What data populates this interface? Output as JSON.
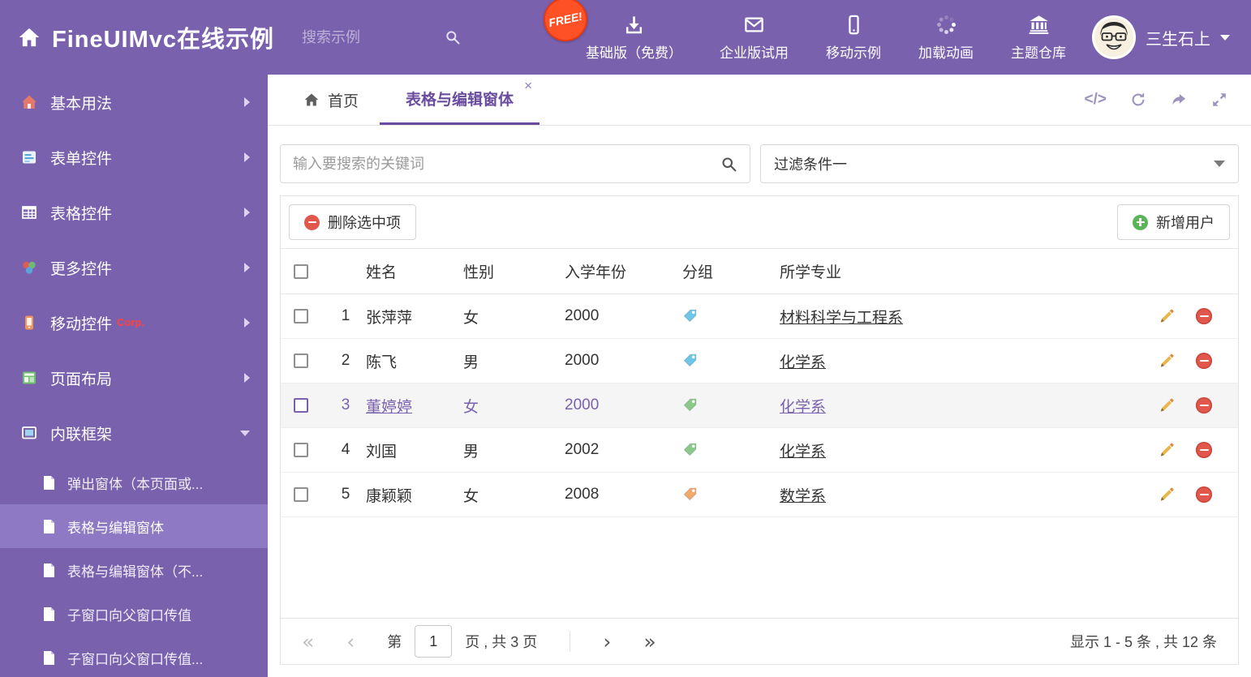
{
  "colors": {
    "accent_purple": "#7a61ae",
    "sidebar_active": "#8d79c4",
    "tab_active": "#6a4c9f",
    "free_badge_bg": "#ff5126",
    "delete_red": "#e2574c",
    "add_green": "#58b558",
    "edit_orange": "#e8b64c"
  },
  "header": {
    "title": "FineUIMvc在线示例",
    "search_placeholder": "搜索示例",
    "free_badge": "FREE!",
    "nav": [
      {
        "label": "基础版（免费）",
        "icon": "download-icon"
      },
      {
        "label": "企业版试用",
        "icon": "envelope-icon"
      },
      {
        "label": "移动示例",
        "icon": "mobile-icon"
      },
      {
        "label": "加载动画",
        "icon": "spinner-icon"
      },
      {
        "label": "主题仓库",
        "icon": "bank-icon"
      }
    ],
    "username": "三生石上"
  },
  "sidebar": {
    "items": [
      {
        "label": "基本用法"
      },
      {
        "label": "表单控件"
      },
      {
        "label": "表格控件"
      },
      {
        "label": "更多控件"
      },
      {
        "label": "移动控件",
        "badge": "Corp."
      },
      {
        "label": "页面布局"
      },
      {
        "label": "内联框架"
      }
    ],
    "subitems": [
      {
        "label": "弹出窗体（本页面或..."
      },
      {
        "label": "表格与编辑窗体"
      },
      {
        "label": "表格与编辑窗体（不..."
      },
      {
        "label": "子窗口向父窗口传值"
      },
      {
        "label": "子窗口向父窗口传值..."
      }
    ]
  },
  "tabs": {
    "home": "首页",
    "active": "表格与编辑窗体",
    "close_glyph": "×"
  },
  "tab_tools": {
    "code_glyph": "</>"
  },
  "filter": {
    "search_placeholder": "输入要搜索的关键词",
    "selected": "过滤条件一"
  },
  "toolbar": {
    "delete_label": "删除选中项",
    "add_label": "新增用户"
  },
  "table": {
    "headers": {
      "name": "姓名",
      "gender": "性别",
      "year": "入学年份",
      "group": "分组",
      "major": "所学专业"
    },
    "rows": [
      {
        "num": "1",
        "name": "张萍萍",
        "gender": "女",
        "year": "2000",
        "tag_color": "#6ec6e8",
        "major": "材料科学与工程系"
      },
      {
        "num": "2",
        "name": "陈飞",
        "gender": "男",
        "year": "2000",
        "tag_color": "#6ec6e8",
        "major": "化学系"
      },
      {
        "num": "3",
        "name": "董婷婷",
        "gender": "女",
        "year": "2000",
        "tag_color": "#8bc98b",
        "major": "化学系"
      },
      {
        "num": "4",
        "name": "刘国",
        "gender": "男",
        "year": "2002",
        "tag_color": "#8bc98b",
        "major": "化学系"
      },
      {
        "num": "5",
        "name": "康颖颖",
        "gender": "女",
        "year": "2008",
        "tag_color": "#f2a96b",
        "major": "数学系"
      }
    ]
  },
  "pagination": {
    "first_glyph": "«",
    "prev_glyph": "‹",
    "prefix": "第",
    "page": "1",
    "suffix": "页 , 共 3 页",
    "next_glyph": "›",
    "last_glyph": "»",
    "summary": "显示 1 - 5 条 , 共 12 条"
  }
}
